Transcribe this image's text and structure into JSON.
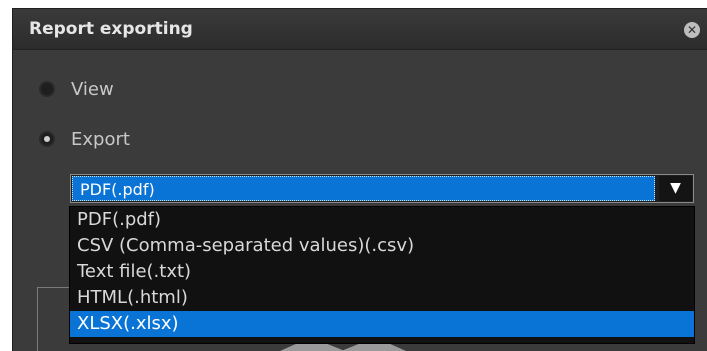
{
  "dialog": {
    "title": "Report exporting",
    "close_icon": "close-icon"
  },
  "options": {
    "view_label": "View",
    "export_label": "Export",
    "selected_mode": "Export"
  },
  "format_select": {
    "value": "PDF(.pdf)",
    "arrow_icon": "chevron-down-icon",
    "dropdown_items": [
      "PDF(.pdf)",
      "CSV (Comma-separated values)(.csv)",
      "Text file(.txt)",
      "HTML(.html)",
      "XLSX(.xlsx)"
    ],
    "highlighted_item": "XLSX(.xlsx)"
  },
  "colors": {
    "dialog_bg": "#3b3b3b",
    "titlebar_bg": "#2c2c2c",
    "selection_blue": "#0a74d6",
    "list_bg": "#111111",
    "text": "#d8d8d8"
  }
}
